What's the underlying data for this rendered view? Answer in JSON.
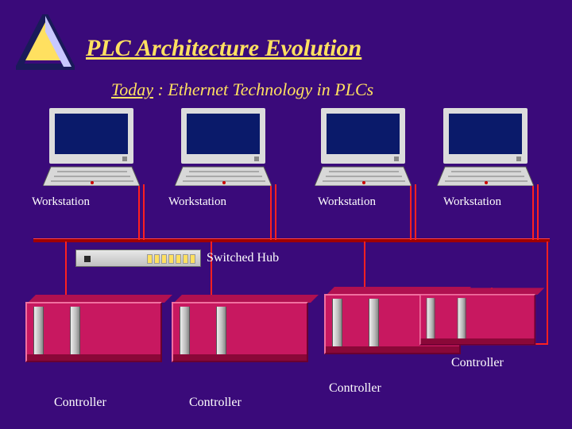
{
  "title": "PLC Architecture Evolution",
  "subtitle_underlined": "Today",
  "subtitle_rest": " : Ethernet Technology in PLCs",
  "workstations": {
    "label1": "Workstation",
    "label2": "Workstation",
    "label3": "Workstation",
    "label4": "Workstation"
  },
  "hub_label": "Switched Hub",
  "controllers": {
    "label1": "Controller",
    "label2": "Controller",
    "label3": "Controller",
    "label4": "Controller"
  }
}
